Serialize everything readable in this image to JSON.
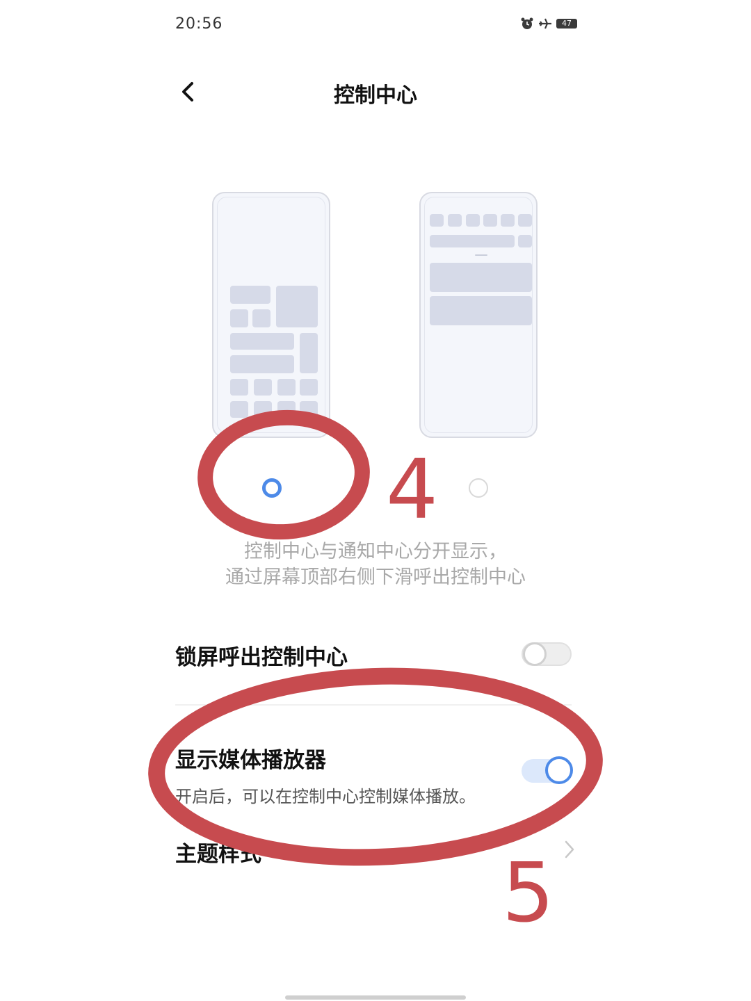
{
  "status_bar": {
    "time": "20:56",
    "icons": [
      "alarm-icon",
      "airplane-icon",
      "battery-icon"
    ],
    "battery_level": "47"
  },
  "header": {
    "title": "控制中心"
  },
  "style_options": [
    {
      "name": "style-a",
      "selected": true
    },
    {
      "name": "style-b",
      "selected": false
    }
  ],
  "description": {
    "line1": "控制中心与通知中心分开显示，",
    "line2": "通过屏幕顶部右侧下滑呼出控制中心"
  },
  "settings": {
    "lockscreen": {
      "label": "锁屏呼出控制中心",
      "enabled": false
    },
    "media_player": {
      "label": "显示媒体播放器",
      "sub": "开启后，可以在控制中心控制媒体播放。",
      "enabled": true
    },
    "theme": {
      "label": "主题样式"
    }
  },
  "annotations": {
    "step_a": "4",
    "step_b": "5",
    "color": "#c74b4f"
  },
  "colors": {
    "accent": "#4d8ae8",
    "muted_text": "#a8a8a8"
  }
}
